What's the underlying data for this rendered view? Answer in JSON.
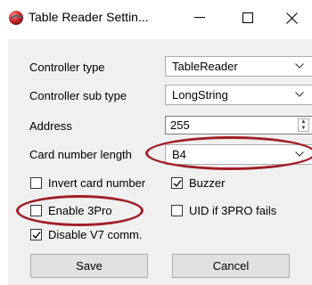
{
  "window": {
    "title": "Table Reader Settin...",
    "app_icon": "red-sphere-icon",
    "minimize": "—",
    "maximize": "□",
    "close": "✕"
  },
  "form": {
    "controller_type_label": "Controller type",
    "controller_type_value": "TableReader",
    "controller_sub_type_label": "Controller sub type",
    "controller_sub_type_value": "LongString",
    "address_label": "Address",
    "address_value": "255",
    "card_number_length_label": "Card number length",
    "card_number_length_value": "B4"
  },
  "checkboxes": {
    "invert_card_number": {
      "label": "Invert card number",
      "checked": false
    },
    "buzzer": {
      "label": "Buzzer",
      "checked": true
    },
    "enable_3pro": {
      "label": "Enable 3Pro",
      "checked": false
    },
    "uid_if_3pro_fails": {
      "label": "UID if 3PRO fails",
      "checked": false
    },
    "disable_v7_comm": {
      "label": "Disable V7 comm.",
      "checked": true
    }
  },
  "buttons": {
    "save": "Save",
    "cancel": "Cancel"
  },
  "colors": {
    "highlight": "#a01f25",
    "panel": "#f0f0f0"
  }
}
